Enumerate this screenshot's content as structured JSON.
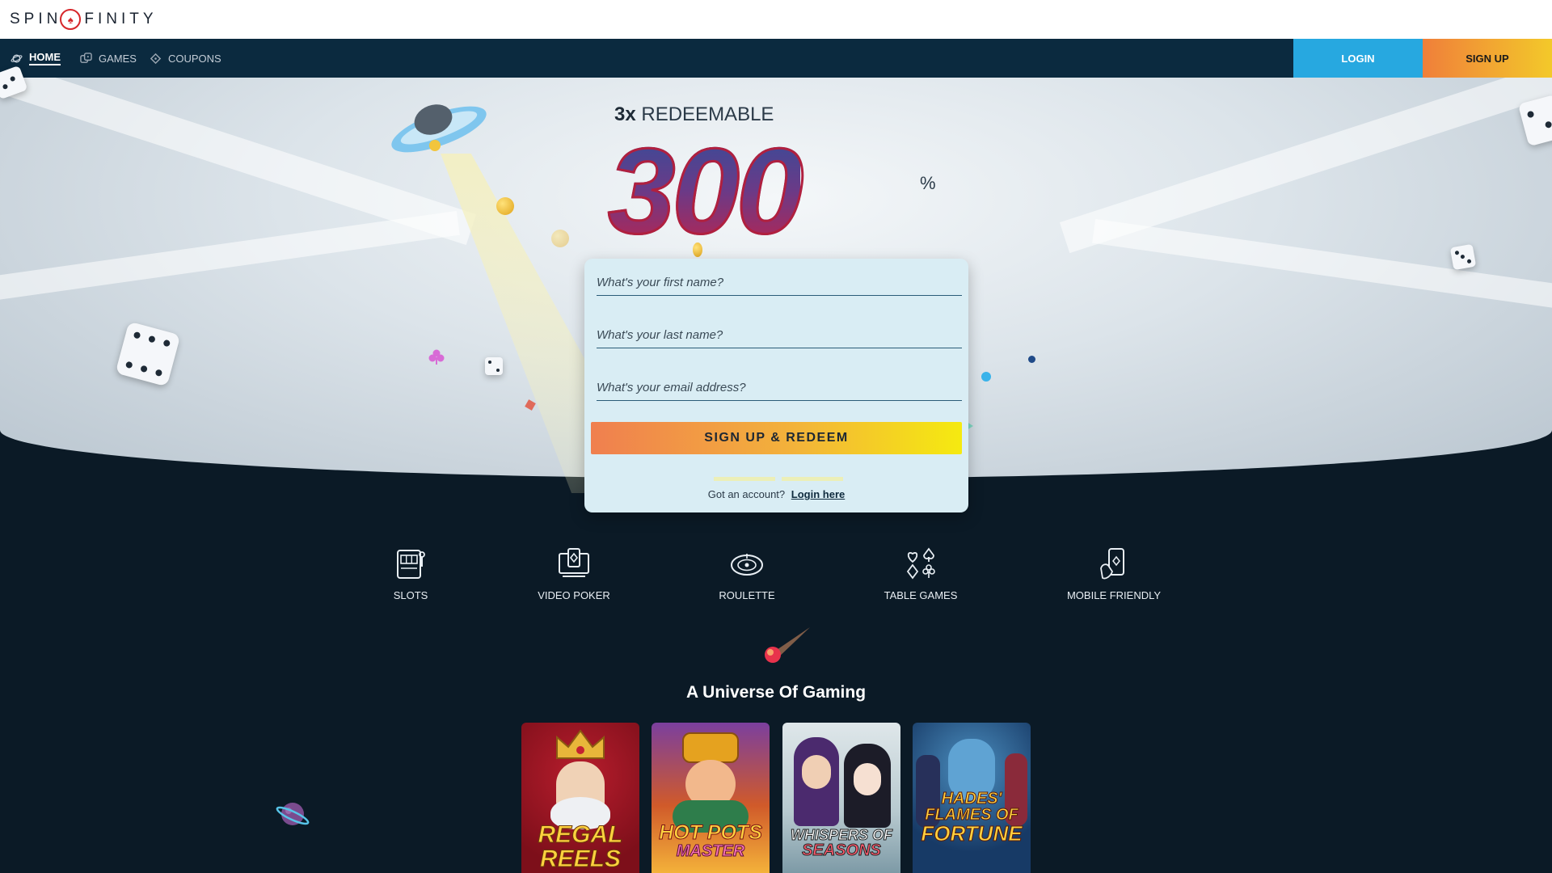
{
  "brand": {
    "name_left": "SPIN",
    "name_right": "FINITY"
  },
  "nav": {
    "items": [
      {
        "label": "HOME",
        "icon": "planet-icon",
        "active": true
      },
      {
        "label": "GAMES",
        "icon": "dice-icon",
        "active": false
      },
      {
        "label": "COUPONS",
        "icon": "ticket-icon",
        "active": false
      }
    ],
    "login_label": "LOGIN",
    "signup_label": "SIGN UP"
  },
  "promo": {
    "multiplier": "3x",
    "redeemable": "REDEEMABLE",
    "amount": "300",
    "unit": "%"
  },
  "form": {
    "first_name_placeholder": "What's your first name?",
    "last_name_placeholder": "What's your last name?",
    "email_placeholder": "What's your email address?",
    "submit_label": "SIGN UP & REDEEM",
    "account_prompt": "Got an account?",
    "login_link": "Login here"
  },
  "categories": [
    {
      "label": "SLOTS",
      "icon": "slot-machine-icon"
    },
    {
      "label": "VIDEO POKER",
      "icon": "video-poker-icon"
    },
    {
      "label": "ROULETTE",
      "icon": "roulette-icon"
    },
    {
      "label": "TABLE GAMES",
      "icon": "card-suits-icon"
    },
    {
      "label": "MOBILE FRIENDLY",
      "icon": "mobile-phone-icon"
    }
  ],
  "section_title": "A Universe Of Gaming",
  "games": [
    {
      "title_line1": "REGAL",
      "title_line2": "REELS"
    },
    {
      "title_line1": "HOT POTS",
      "title_line2": "MASTER"
    },
    {
      "title_line1": "WHISPERS OF",
      "title_line2": "SEASONS"
    },
    {
      "title_line1": "HADES' FLAMES OF",
      "title_line2": "FORTUNE"
    }
  ],
  "colors": {
    "nav_bg": "#0b2a3f",
    "page_bg": "#0b1a26",
    "login_blue": "#27a8e0",
    "signup_orange": "#f07f3a",
    "signup_yellow": "#f3c92a"
  }
}
